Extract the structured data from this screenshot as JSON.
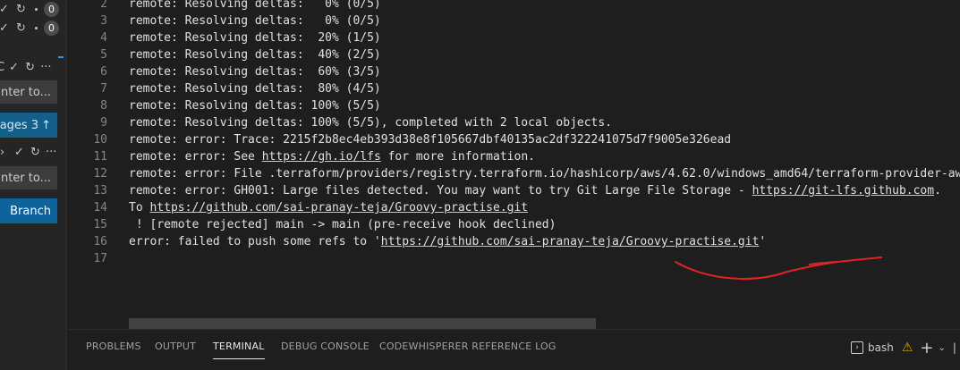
{
  "sidebar": {
    "row1_count": "0",
    "row2_count": "0",
    "commit_input_1_placeholder": "Enter to...",
    "changes_button_label": "ages 3",
    "changes_button_arrow": "↑",
    "commit_input_2_placeholder": "Enter to...",
    "branch_button_label": "Branch",
    "row3_ellipsis": "···",
    "row3_prefix": "C"
  },
  "terminal": {
    "lines": [
      {
        "n": "2",
        "text": "remote: Resolving deltas:   0% (0/5)"
      },
      {
        "n": "3",
        "text": "remote: Resolving deltas:   0% (0/5)"
      },
      {
        "n": "4",
        "text": "remote: Resolving deltas:  20% (1/5)"
      },
      {
        "n": "5",
        "text": "remote: Resolving deltas:  40% (2/5)"
      },
      {
        "n": "6",
        "text": "remote: Resolving deltas:  60% (3/5)"
      },
      {
        "n": "7",
        "text": "remote: Resolving deltas:  80% (4/5)"
      },
      {
        "n": "8",
        "text": "remote: Resolving deltas: 100% (5/5)"
      },
      {
        "n": "9",
        "text": "remote: Resolving deltas: 100% (5/5), completed with 2 local objects."
      },
      {
        "n": "10",
        "text": "remote: error: Trace: 2215f2b8ec4eb393d38e8f105667dbf40135ac2df322241075d7f9005e326ead"
      },
      {
        "n": "11",
        "pre": "remote: error: See ",
        "link": "https://gh.io/lfs",
        "post": " for more information."
      },
      {
        "n": "12",
        "text": "remote: error: File .terraform/providers/registry.terraform.io/hashicorp/aws/4.62.0/windows_amd64/terraform-provider-aws"
      },
      {
        "n": "13",
        "pre": "remote: error: GH001: Large files detected. You may want to try Git Large File Storage - ",
        "link": "https://git-lfs.github.com",
        "post": "."
      },
      {
        "n": "14",
        "pre": "To ",
        "link": "https://github.com/sai-pranay-teja/Groovy-practise.git",
        "post": ""
      },
      {
        "n": "15",
        "text": " ! [remote rejected] main -> main (pre-receive hook declined)"
      },
      {
        "n": "16",
        "pre": "error: failed to push some refs to '",
        "link": "https://github.com/sai-pranay-teja/Groovy-practise.git",
        "post": "'"
      },
      {
        "n": "17",
        "text": ""
      }
    ]
  },
  "panel": {
    "tabs": [
      "PROBLEMS",
      "OUTPUT",
      "TERMINAL",
      "DEBUG CONSOLE",
      "CODEWHISPERER REFERENCE LOG"
    ],
    "active_tab": "TERMINAL",
    "shell_label": "bash",
    "icons": [
      "terminal-icon",
      "warning-icon",
      "add-icon",
      "chevron-down-icon",
      "more-icon"
    ]
  },
  "colors": {
    "background": "#1e1e1e",
    "sidebar": "#252526",
    "button": "#0e639c",
    "annotation": "#e02424",
    "warning": "#cca700"
  }
}
